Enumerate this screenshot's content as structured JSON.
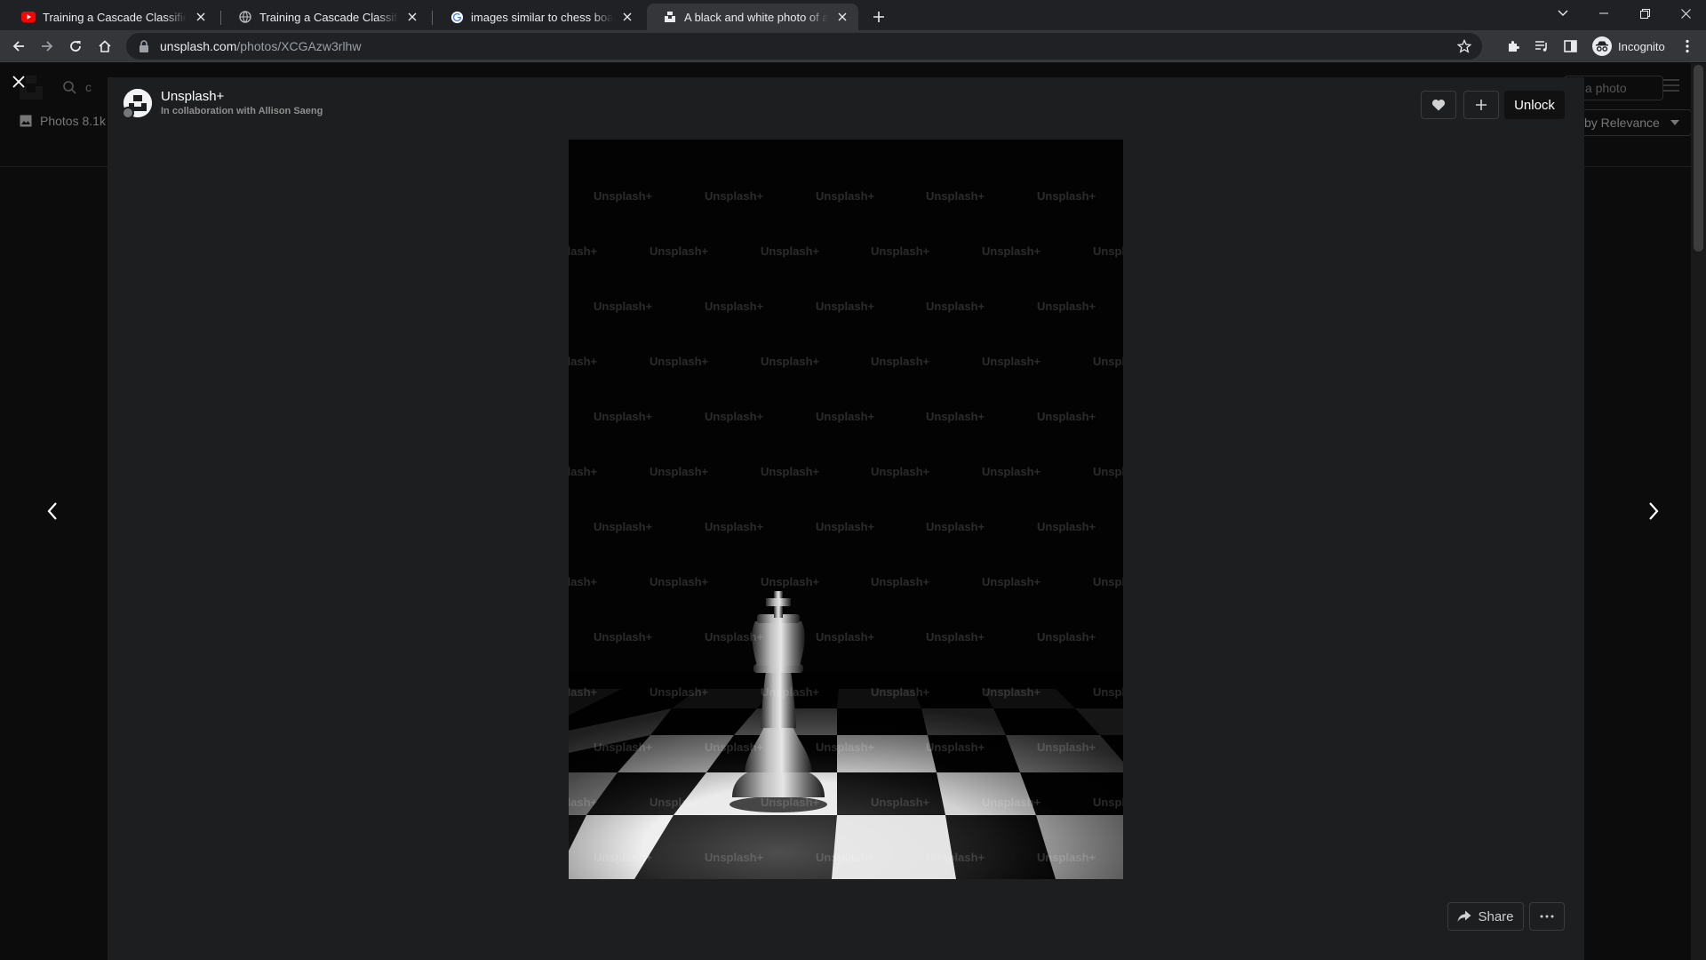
{
  "browser": {
    "tabs": [
      {
        "title": "Training a Cascade Classifier - OpenCV",
        "icon": "youtube-icon"
      },
      {
        "title": "Training a Cascade Classifier - LearnOpenCV",
        "icon": "globe-icon"
      },
      {
        "title": "images similar to chess board - Google Search",
        "icon": "google-icon"
      },
      {
        "title": "A black and white photo of a chess king",
        "icon": "unsplash-icon"
      }
    ],
    "url_host": "unsplash.com",
    "url_path": "/photos/XCGAzw3rlhw",
    "profile_label": "Incognito"
  },
  "background": {
    "search_placeholder": "c",
    "photos_tab": "Photos 8.1k",
    "submit_label": "it a photo",
    "sort_label": "by Relevance"
  },
  "modal": {
    "author_name": "Unsplash+",
    "author_collab": "In collaboration with Allison Saeng",
    "unlock_label": "Unlock",
    "share_label": "Share",
    "watermark": "Unsplash+"
  },
  "colors": {
    "modal_bg": "#1d1e20",
    "page_bg": "#0c0c0c",
    "chrome_tabstrip": "#202124",
    "chrome_toolbar": "#35363a"
  }
}
